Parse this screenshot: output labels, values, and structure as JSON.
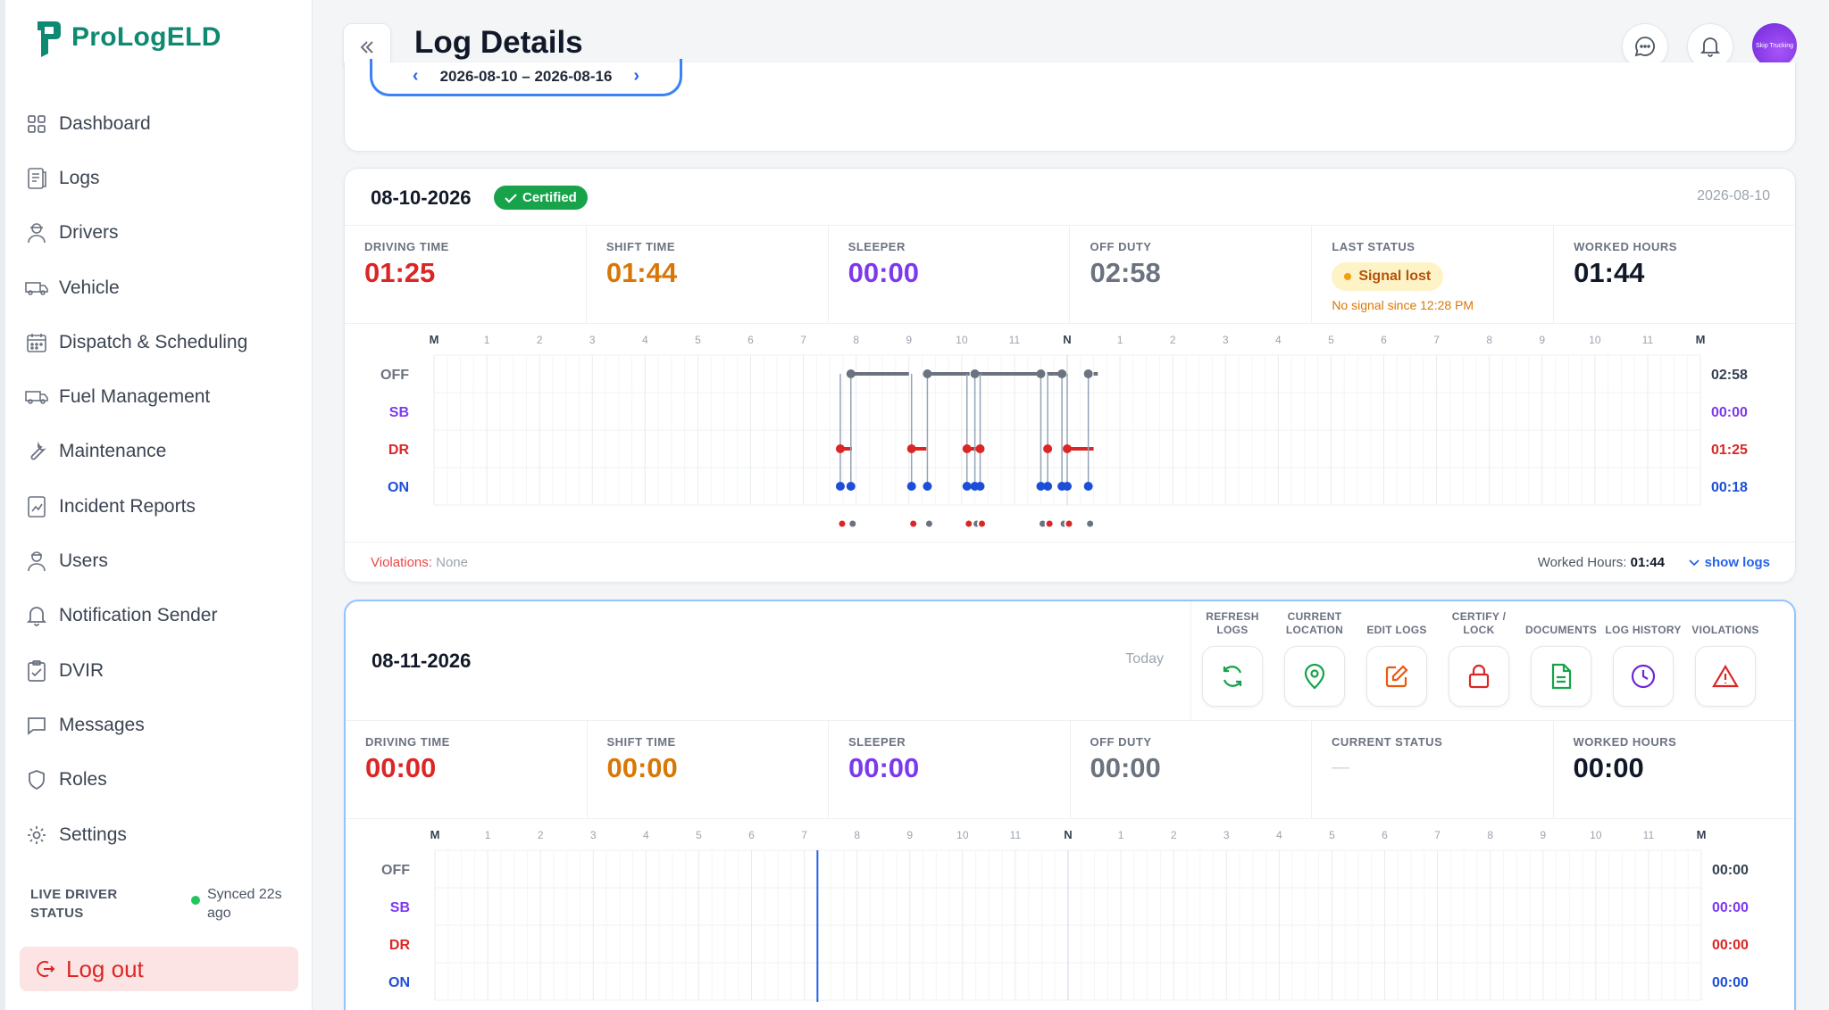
{
  "app": {
    "logo_text": "ProLogELD"
  },
  "sidebar": {
    "items": [
      {
        "label": "Dashboard"
      },
      {
        "label": "Logs"
      },
      {
        "label": "Drivers"
      },
      {
        "label": "Vehicle"
      },
      {
        "label": "Dispatch & Scheduling"
      },
      {
        "label": "Fuel Management"
      },
      {
        "label": "Maintenance"
      },
      {
        "label": "Incident Reports"
      },
      {
        "label": "Users"
      },
      {
        "label": "Notification Sender"
      },
      {
        "label": "DVIR"
      },
      {
        "label": "Messages"
      },
      {
        "label": "Roles"
      },
      {
        "label": "Settings"
      }
    ],
    "live_label": "LIVE DRIVER STATUS",
    "live_sync": "Synced 22s ago",
    "logout_label": "Log out"
  },
  "header": {
    "title": "Log Details",
    "avatar_text": "Skip Trucking"
  },
  "week": {
    "range": "2026-08-10 – 2026-08-16",
    "prev": "‹",
    "next": "›"
  },
  "hour_labels": [
    "M",
    "1",
    "2",
    "3",
    "4",
    "5",
    "6",
    "7",
    "8",
    "9",
    "10",
    "11",
    "N",
    "1",
    "2",
    "3",
    "4",
    "5",
    "6",
    "7",
    "8",
    "9",
    "10",
    "11",
    "M"
  ],
  "status_rows": [
    "OFF",
    "SB",
    "DR",
    "ON"
  ],
  "day1": {
    "date": "08-10-2026",
    "badge": "Certified",
    "right_date": "2026-08-10",
    "stats": {
      "driving_label": "DRIVING TIME",
      "driving": "01:25",
      "shift_label": "SHIFT TIME",
      "shift": "01:44",
      "sleeper_label": "SLEEPER",
      "sleeper": "00:00",
      "off_label": "OFF DUTY",
      "off": "02:58",
      "last_label": "LAST STATUS",
      "last_badge": "Signal lost",
      "last_sub": "No signal since 12:28 PM",
      "worked_label": "WORKED HOURS",
      "worked": "01:44"
    },
    "totals": [
      "02:58",
      "00:00",
      "01:25",
      "00:18"
    ],
    "violations_label": "Violations:",
    "violations": "None",
    "worked_footer_label": "Worked Hours:",
    "worked_footer": "01:44",
    "show_logs": "show logs"
  },
  "day2": {
    "date": "08-11-2026",
    "right_label": "Today",
    "tools": [
      {
        "label": "REFRESH LOGS",
        "icon": "refresh-icon",
        "color": "#16a34a"
      },
      {
        "label": "CURRENT LOCATION",
        "icon": "location-pin-icon",
        "color": "#16a34a"
      },
      {
        "label": "EDIT LOGS",
        "icon": "edit-icon",
        "color": "#ea580c"
      },
      {
        "label": "CERTIFY / LOCK",
        "icon": "lock-icon",
        "color": "#dc2626"
      },
      {
        "label": "DOCUMENTS",
        "icon": "document-icon",
        "color": "#16a34a"
      },
      {
        "label": "LOG HISTORY",
        "icon": "clock-icon",
        "color": "#6d28d9"
      },
      {
        "label": "VIOLATIONS",
        "icon": "warning-icon",
        "color": "#dc2626"
      }
    ],
    "stats": {
      "driving_label": "DRIVING TIME",
      "driving": "00:00",
      "shift_label": "SHIFT TIME",
      "shift": "00:00",
      "sleeper_label": "SLEEPER",
      "sleeper": "00:00",
      "off_label": "OFF DUTY",
      "off": "00:00",
      "current_label": "CURRENT STATUS",
      "current": "—",
      "worked_label": "WORKED HOURS",
      "worked": "00:00"
    },
    "totals": [
      "00:00",
      "00:00",
      "00:00",
      "00:00"
    ]
  },
  "colors": {
    "off": "#6b7280",
    "sb": "#7c3aed",
    "dr": "#dc2626",
    "on": "#1d4ed8",
    "brand": "#0f8a72"
  }
}
